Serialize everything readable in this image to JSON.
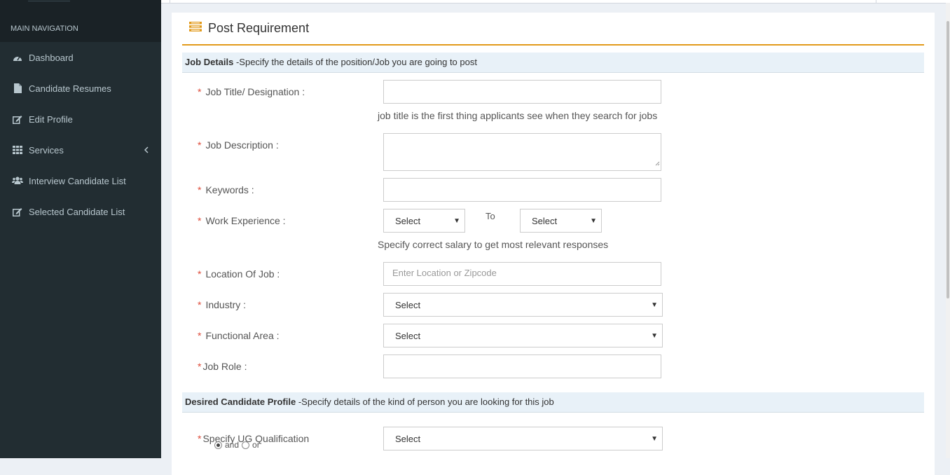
{
  "sidebar": {
    "header": "MAIN NAVIGATION",
    "items": [
      {
        "label": "Dashboard",
        "icon": "dashboard-icon"
      },
      {
        "label": "Candidate Resumes",
        "icon": "file-icon"
      },
      {
        "label": "Edit Profile",
        "icon": "edit-icon"
      },
      {
        "label": "Services",
        "icon": "grid-icon"
      },
      {
        "label": "Interview Candidate List",
        "icon": "users-icon"
      },
      {
        "label": "Selected Candidate List",
        "icon": "edit-icon"
      }
    ]
  },
  "panel": {
    "title": "Post Requirement"
  },
  "sections": {
    "job_details": {
      "title": "Job Details",
      "desc": " -Specify the details of the position/Job you are going to post"
    },
    "candidate_profile": {
      "title": "Desired Candidate Profile",
      "desc": " -Specify details of the kind of person you are looking for this job"
    }
  },
  "form": {
    "job_title": {
      "label": "Job Title/ Designation :",
      "value": "",
      "hint": "job title is the first thing applicants see when they search for jobs"
    },
    "job_description": {
      "label": "Job Description :",
      "value": ""
    },
    "keywords": {
      "label": "Keywords :",
      "value": ""
    },
    "work_experience": {
      "label": "Work Experience :",
      "from": "Select",
      "to_label": "To",
      "to": "Select",
      "hint": "Specify correct salary to get most relevant responses"
    },
    "location": {
      "label": "Location Of Job :",
      "placeholder": "Enter Location or Zipcode"
    },
    "industry": {
      "label": "Industry :",
      "value": "Select"
    },
    "functional_area": {
      "label": "Functional Area :",
      "value": "Select"
    },
    "job_role": {
      "label": "Job Role :",
      "value": ""
    },
    "ug_qualification": {
      "label": "Specify UG Qualification",
      "value": "Select"
    },
    "ug_condition": {
      "options": [
        "and",
        "or"
      ],
      "selected": "and"
    }
  },
  "required_marker": "*",
  "colors": {
    "sidebar_bg": "#222d32",
    "accent": "#e29a1b",
    "section_bg": "#e8f1f8",
    "required": "#dd4b39"
  }
}
